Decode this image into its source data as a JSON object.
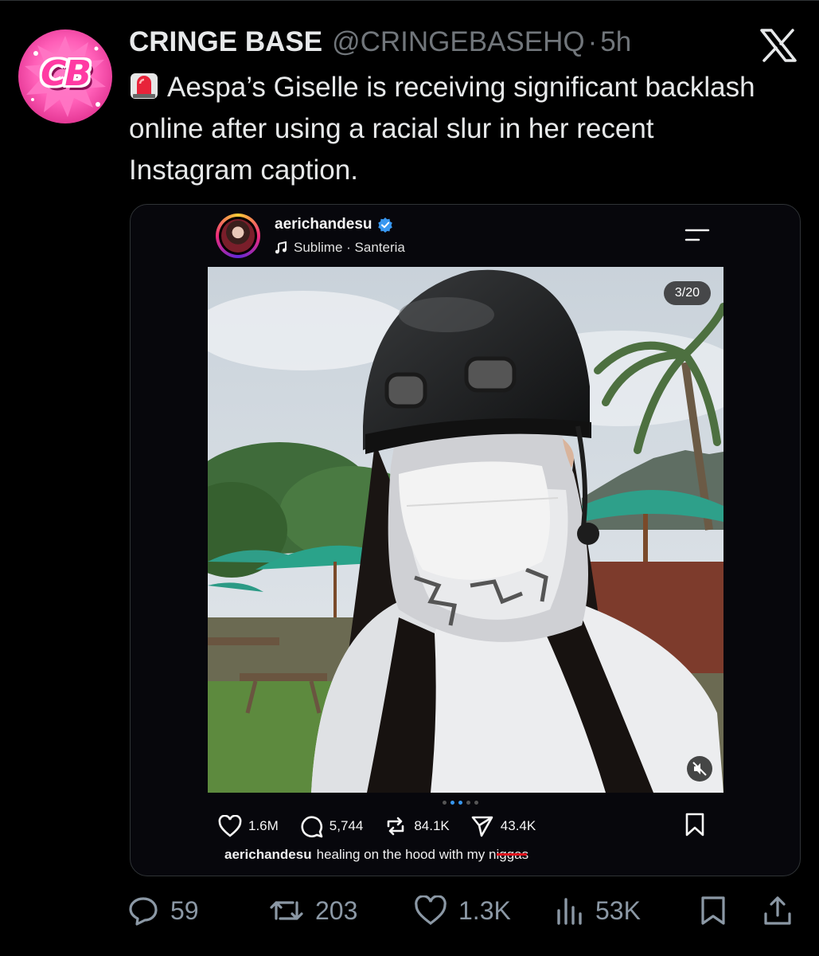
{
  "tweet": {
    "author_name": "CRINGE BASE",
    "handle": "@CRINGEBASEHQ",
    "separator": "·",
    "time": "5h",
    "avatar_text": "CB",
    "text": "Aespa’s Giselle is receiving significant backlash online after using a racial slur in her recent Instagram caption.",
    "icons": {
      "siren": "police-light-emoji",
      "platform": "x-logo"
    }
  },
  "instagram_post": {
    "username": "aerichandesu",
    "song": "Sublime · Santeria",
    "counter": "3/20",
    "likes": "1.6M",
    "comments": "5,744",
    "reposts": "84.1K",
    "shares": "43.4K",
    "caption_user": "aerichandesu",
    "caption_text": "healing on the hood with my niggas",
    "carousel_active_index": 2,
    "carousel_dot_count": 5,
    "colors": {
      "verified": "#3897f0",
      "redact_line": "#e0141e"
    }
  },
  "actions": {
    "replies": "59",
    "reposts": "203",
    "likes": "1.3K",
    "views": "53K"
  }
}
